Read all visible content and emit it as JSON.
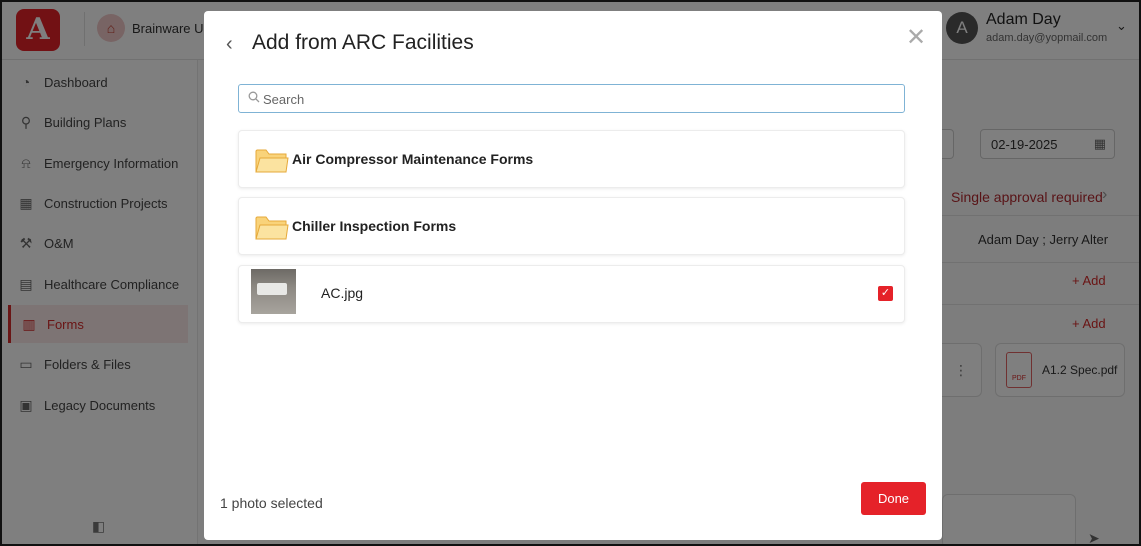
{
  "app": {
    "logo_letter": "A",
    "org_name": "Brainware Un",
    "user": {
      "initial": "A",
      "name": "Adam Day",
      "email": "adam.day@yopmail.com"
    }
  },
  "sidebar": {
    "items": [
      {
        "label": "Dashboard",
        "icon": "dashboard-icon"
      },
      {
        "label": "Building Plans",
        "icon": "location-pin-icon"
      },
      {
        "label": "Emergency Information",
        "icon": "alarm-icon"
      },
      {
        "label": "Construction Projects",
        "icon": "building-icon"
      },
      {
        "label": "O&M",
        "icon": "tools-icon"
      },
      {
        "label": "Healthcare Compliance",
        "icon": "clipboard-icon"
      },
      {
        "label": "Forms",
        "icon": "form-icon",
        "active": true
      },
      {
        "label": "Folders & Files",
        "icon": "folder-icon"
      },
      {
        "label": "Legacy Documents",
        "icon": "document-icon"
      }
    ]
  },
  "background": {
    "date_value": "02-19-2025",
    "approval_text": "Single approval required",
    "approvers": "Adam Day ;   Jerry Alter",
    "add_label": "Add",
    "file_name": "A1.2 Spec.pdf",
    "pdf_badge": "PDF"
  },
  "modal": {
    "title": "Add from ARC Facilities",
    "search": {
      "placeholder": "Search",
      "value": ""
    },
    "items": [
      {
        "type": "folder",
        "name": "Air Compressor Maintenance Forms"
      },
      {
        "type": "folder",
        "name": "Chiller Inspection Forms"
      },
      {
        "type": "image",
        "name": "AC.jpg",
        "checked": true
      }
    ],
    "status": "1 photo selected",
    "done_label": "Done"
  },
  "colors": {
    "brand_red": "#e52229",
    "folder_yellow": "#f5c35a",
    "search_border": "#7fb3d5"
  }
}
